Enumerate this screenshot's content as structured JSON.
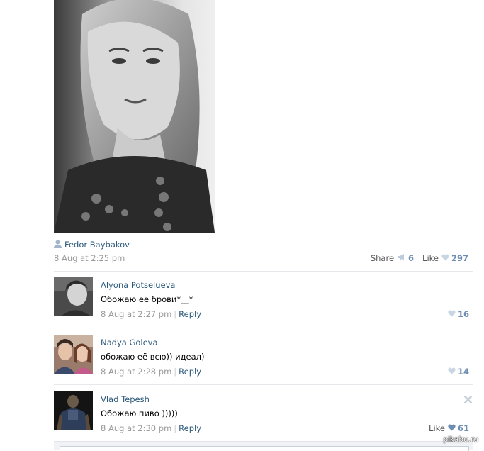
{
  "post": {
    "author": "Fedor Baybakov",
    "date": "8 Aug at 2:25 pm",
    "share_label": "Share",
    "share_count": "6",
    "like_label": "Like",
    "like_count": "297",
    "photo_alt": "Black-and-white portrait photo"
  },
  "comments": [
    {
      "name": "Alyona Potselueva",
      "text": "Обожаю ее брови*__*",
      "date": "8 Aug at 2:27 pm",
      "reply_label": "Reply",
      "like_count": "16"
    },
    {
      "name": "Nadya Goleva",
      "text": "обожаю её всю)) идеал)",
      "date": "8 Aug at 2:28 pm",
      "reply_label": "Reply",
      "like_count": "14"
    },
    {
      "name": "Vlad Tepesh",
      "text": "Обожаю пиво )))))",
      "date": "8 Aug at 2:30 pm",
      "reply_label": "Reply",
      "like_label": "Like",
      "like_count": "61"
    }
  ],
  "watermark": "pikabu.ru",
  "colors": {
    "link": "#2b587a",
    "muted": "#999999",
    "count": "#6e8db3",
    "separator": "#e7e8ec"
  }
}
